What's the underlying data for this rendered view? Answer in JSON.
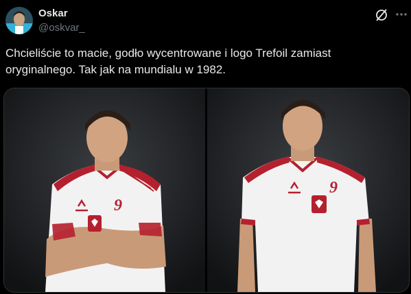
{
  "author": {
    "display_name": "Oskar",
    "handle": "@oskvar_"
  },
  "tweet": {
    "text": "Chcieliście to macie, godło wycentrowane i logo Trefoil zamiast oryginalnego. Tak jak na mundialu w 1982."
  },
  "media": {
    "left": {
      "jersey_number": "9"
    },
    "right": {
      "jersey_number": "9"
    }
  },
  "icons": {
    "grok": "grok-icon",
    "more": "more-icon"
  },
  "colors": {
    "background": "#000000",
    "text_primary": "#e7e9ea",
    "text_secondary": "#71767b",
    "jersey_white": "#f2f2f2",
    "jersey_red": "#b5202e"
  }
}
